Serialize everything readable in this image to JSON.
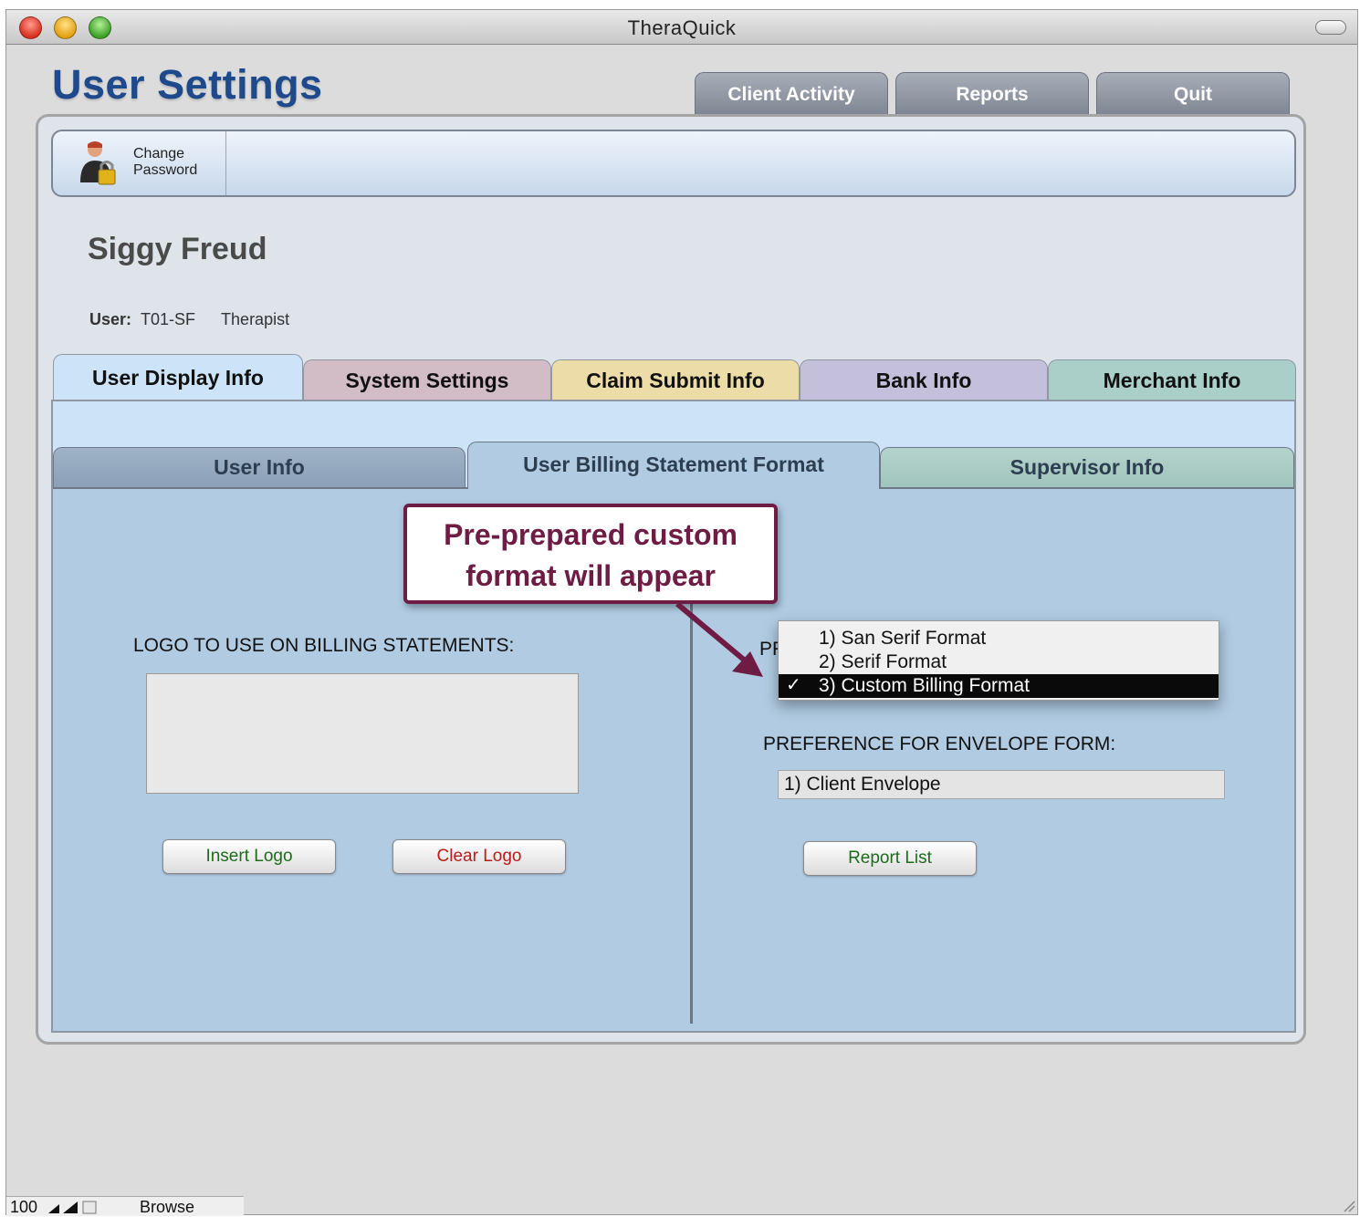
{
  "window": {
    "title": "TheraQuick"
  },
  "page": {
    "title": "User Settings"
  },
  "top_tabs": [
    {
      "label": "Client Activity"
    },
    {
      "label": "Reports"
    },
    {
      "label": "Quit"
    }
  ],
  "toolbar": {
    "change_password_label": "Change Password"
  },
  "user": {
    "name": "Siggy Freud",
    "user_label": "User:",
    "user_id": "T01-SF",
    "role": "Therapist"
  },
  "main_tabs": [
    {
      "label": "User Display Info",
      "color": "#cde4f8"
    },
    {
      "label": "System Settings",
      "color": "#d2bcc6"
    },
    {
      "label": "Claim Submit Info",
      "color": "#ebdca8"
    },
    {
      "label": "Bank Info",
      "color": "#c4c0dc"
    },
    {
      "label": "Merchant Info",
      "color": "#a9cfc8"
    }
  ],
  "sub_tabs": [
    {
      "label": "User Info"
    },
    {
      "label": "User Billing Statement Format"
    },
    {
      "label": "Supervisor Info"
    }
  ],
  "billing": {
    "logo_label": "LOGO TO USE ON BILLING STATEMENTS:",
    "insert_logo": "Insert Logo",
    "clear_logo": "Clear Logo",
    "pref_label_partial": "PR",
    "dropdown_options": [
      {
        "label": "1) San Serif Format",
        "checked": false
      },
      {
        "label": "2) Serif Format",
        "checked": false
      },
      {
        "label": "3) Custom Billing Format",
        "checked": true
      }
    ],
    "check_mark": "✓",
    "envelope_label": "PREFERENCE FOR ENVELOPE FORM:",
    "envelope_value": "1) Client Envelope",
    "report_list": "Report List"
  },
  "callout": {
    "line1": "Pre-prepared custom",
    "line2": "format will appear"
  },
  "status": {
    "zoom": "100",
    "mode": "Browse"
  }
}
